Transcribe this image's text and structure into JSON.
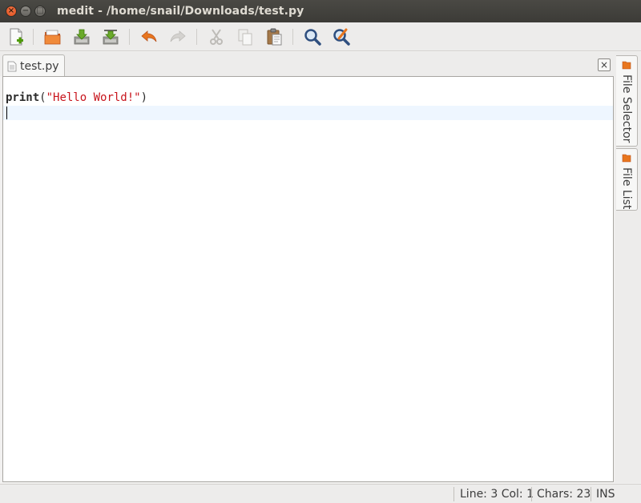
{
  "window": {
    "title": "medit - /home/snail/Downloads/test.py",
    "buttons": {
      "close": "×",
      "minimize": "−",
      "maximize": "□"
    }
  },
  "toolbar": {
    "items": [
      {
        "name": "new-file",
        "icon": "new-document-icon"
      },
      {
        "name": "open",
        "icon": "open-folder-icon"
      },
      {
        "name": "save",
        "icon": "save-icon"
      },
      {
        "name": "save-as",
        "icon": "save-as-icon"
      },
      {
        "name": "undo",
        "icon": "undo-icon"
      },
      {
        "name": "redo",
        "icon": "redo-icon"
      },
      {
        "name": "cut",
        "icon": "cut-icon"
      },
      {
        "name": "copy",
        "icon": "copy-icon"
      },
      {
        "name": "paste",
        "icon": "paste-icon"
      },
      {
        "name": "find",
        "icon": "search-icon"
      },
      {
        "name": "find-replace",
        "icon": "find-replace-icon"
      }
    ]
  },
  "tabs": [
    {
      "label": "test.py",
      "active": true
    }
  ],
  "tab_close": "×",
  "editor": {
    "lines": [
      {
        "tokens": [
          {
            "type": "kw",
            "text": "print"
          },
          {
            "type": "punc",
            "text": "("
          },
          {
            "type": "str",
            "text": "\"Hello World!\""
          },
          {
            "type": "punc",
            "text": ")"
          }
        ]
      },
      {
        "tokens": []
      }
    ],
    "line1": {
      "kw": "print",
      "open": "(",
      "str": "\"Hello World!\"",
      "close": ")"
    },
    "current_line_color": "#eef6ff",
    "string_color": "#c8141c"
  },
  "side_panel": {
    "tabs": [
      {
        "label": "File Selector"
      },
      {
        "label": "File List"
      }
    ]
  },
  "statusbar": {
    "position": "Line: 3 Col: 1",
    "chars": "Chars: 23",
    "mode": "INS"
  },
  "colors": {
    "titlebar": "#3c3b37",
    "close_button": "#df4a16",
    "accent_orange": "#e8761e"
  }
}
